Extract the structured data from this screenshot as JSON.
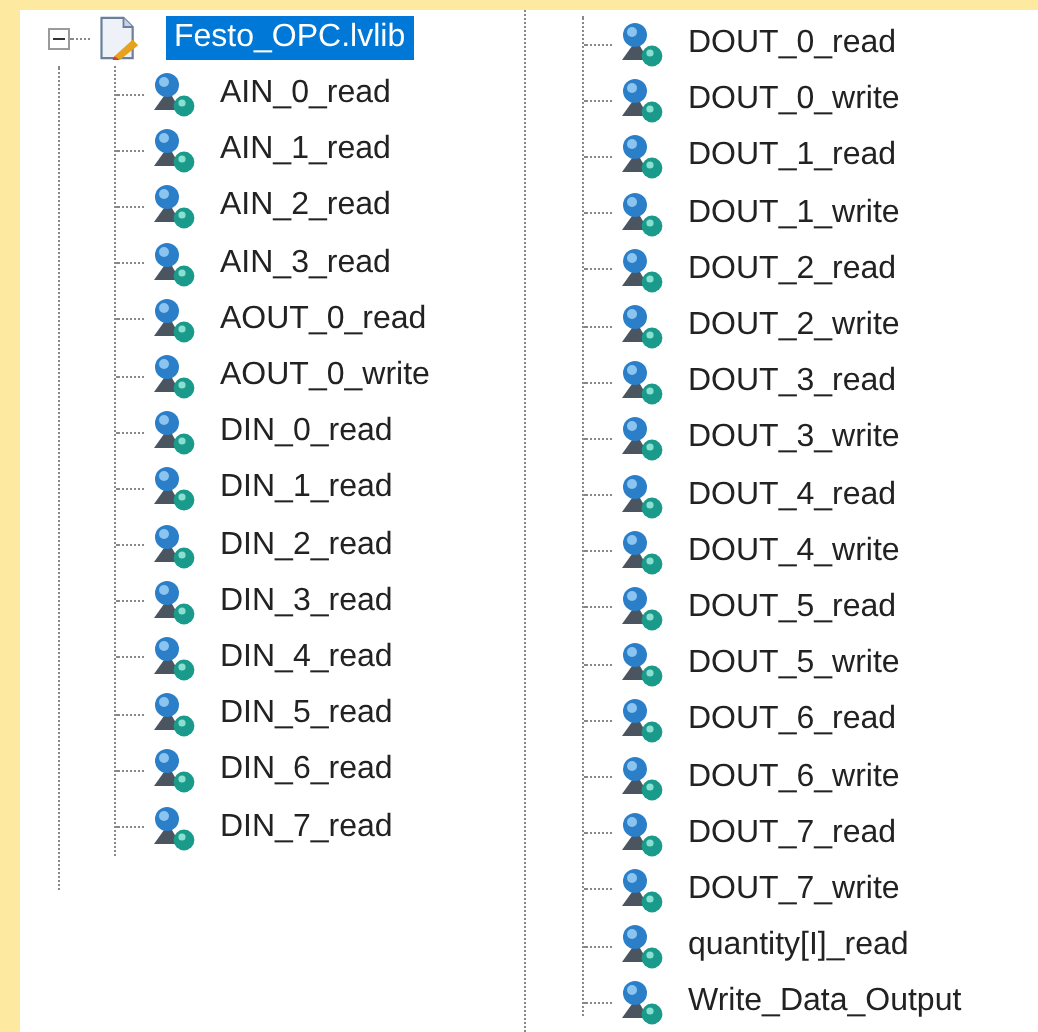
{
  "tree": {
    "root": {
      "label": "Festo_OPC.lvlib",
      "selected": true,
      "expanded": true,
      "children": [
        {
          "label": "AIN_0_read",
          "selected": false
        },
        {
          "label": "AIN_1_read",
          "selected": false
        },
        {
          "label": "AIN_2_read",
          "selected": false
        },
        {
          "label": "AIN_3_read",
          "selected": false
        },
        {
          "label": "AOUT_0_read",
          "selected": false
        },
        {
          "label": "AOUT_0_write",
          "selected": false
        },
        {
          "label": "DIN_0_read",
          "selected": false
        },
        {
          "label": "DIN_1_read",
          "selected": false
        },
        {
          "label": "DIN_2_read",
          "selected": false
        },
        {
          "label": "DIN_3_read",
          "selected": false
        },
        {
          "label": "DIN_4_read",
          "selected": false
        },
        {
          "label": "DIN_5_read",
          "selected": false
        },
        {
          "label": "DIN_6_read",
          "selected": false
        },
        {
          "label": "DIN_7_read",
          "selected": false
        },
        {
          "label": "DOUT_0_read",
          "selected": false
        },
        {
          "label": "DOUT_0_write",
          "selected": false
        },
        {
          "label": "DOUT_1_read",
          "selected": false
        },
        {
          "label": "DOUT_1_write",
          "selected": false
        },
        {
          "label": "DOUT_2_read",
          "selected": false
        },
        {
          "label": "DOUT_2_write",
          "selected": false
        },
        {
          "label": "DOUT_3_read",
          "selected": false
        },
        {
          "label": "DOUT_3_write",
          "selected": false
        },
        {
          "label": "DOUT_4_read",
          "selected": false
        },
        {
          "label": "DOUT_4_write",
          "selected": false
        },
        {
          "label": "DOUT_5_read",
          "selected": false
        },
        {
          "label": "DOUT_5_write",
          "selected": false
        },
        {
          "label": "DOUT_6_read",
          "selected": false
        },
        {
          "label": "DOUT_6_write",
          "selected": false
        },
        {
          "label": "DOUT_7_read",
          "selected": false
        },
        {
          "label": "DOUT_7_write",
          "selected": false
        },
        {
          "label": "quantity[I]_read",
          "selected": false
        },
        {
          "label": "Write_Data_Output",
          "selected": false
        }
      ]
    }
  }
}
